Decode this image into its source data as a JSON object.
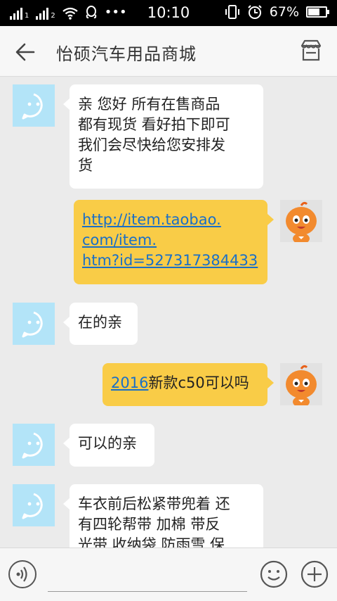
{
  "status_bar": {
    "sim1": "1",
    "sim2": "2",
    "time": "10:10",
    "battery_percent_text": "67%",
    "battery_level": 0.67,
    "more_glyph": "•••"
  },
  "header": {
    "title": "怡硕汽车用品商城",
    "back_icon": "arrow-left-icon",
    "shop_icon": "storefront-icon"
  },
  "messages": [
    {
      "side": "in",
      "lines": [
        "亲 您好 所有在售商品",
        "都有现货 看好拍下即可",
        "我们会尽快给您安排发",
        "货"
      ]
    },
    {
      "side": "out",
      "link_lines": [
        "http://item.taobao.",
        "com/item.",
        "htm?id=527317384433"
      ]
    },
    {
      "side": "in",
      "text": "在的亲"
    },
    {
      "side": "out",
      "link_part": "2016",
      "text_part": "新款c50可以吗"
    },
    {
      "side": "in",
      "text": "可以的亲"
    },
    {
      "side": "in",
      "lines": [
        "车衣前后松紧带兜着 还",
        "有四轮帮带 加棉 带反",
        "光带 收纳袋 防雨雪 保"
      ]
    }
  ],
  "input_bar": {
    "voice_icon": "voice-icon",
    "input_value": "",
    "emoji_icon": "emoji-icon",
    "plus_icon": "plus-icon"
  },
  "colors": {
    "outgoing_bubble": "#f9cc47",
    "incoming_bubble": "#ffffff",
    "link": "#1a6fc7",
    "bot_avatar_bg": "#b3e4f8"
  }
}
